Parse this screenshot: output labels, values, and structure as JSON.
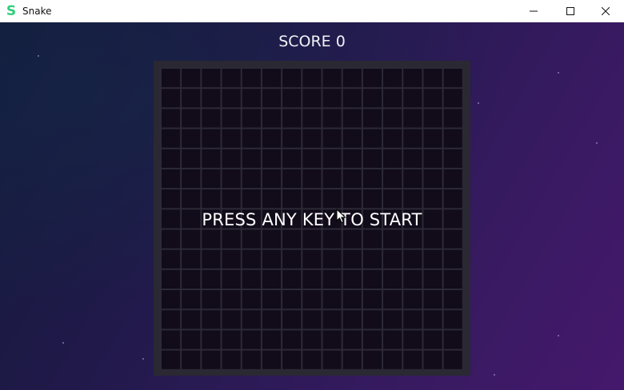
{
  "window": {
    "title": "Snake",
    "app_icon": "S",
    "app_icon_color": "#2fcf7a",
    "controls": [
      "minimize-icon",
      "maximize-icon",
      "close-icon"
    ]
  },
  "game": {
    "score_text": "SCORE 0",
    "start_message": "PRESS ANY KEY TO START",
    "grid_cells": 15
  },
  "colors": {
    "background_start": "#131c3c",
    "background_end": "#45186c",
    "board_frame": "#2a2832",
    "board_cell": "#120b1a",
    "text": "#ffffff"
  }
}
